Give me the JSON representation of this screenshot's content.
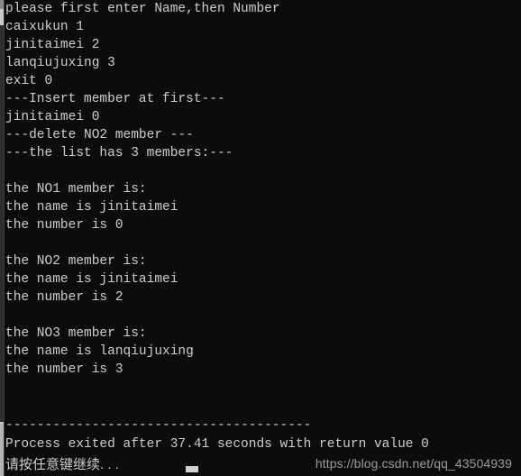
{
  "window": {
    "background_color": "#0c0c0c",
    "text_color": "#cdcdcd",
    "watermark_color": "#9a9a9a",
    "scrollbar_track_color": "#c8c8c8",
    "scrollbar_thumb_color": "#2e2e2e"
  },
  "console": {
    "lines": [
      "please first enter Name,then Number",
      "caixukun 1",
      "jinitaimei 2",
      "lanqiujuxing 3",
      "exit 0",
      "---Insert member at first---",
      "jinitaimei 0",
      "---delete NO2 member ---",
      "---the list has 3 members:---",
      "",
      "the NO1 member is:",
      "the name is jinitaimei",
      "the number is 0",
      "",
      "the NO2 member is:",
      "the name is jinitaimei",
      "the number is 2",
      "",
      "the NO3 member is:",
      "the name is lanqiujuxing",
      "the number is 3",
      "",
      "",
      "",
      ""
    ]
  },
  "footer": {
    "separator": "---------------------------------------",
    "exit_message": "Process exited after 37.41 seconds with return value 0",
    "press_any_key": "请按任意键继续. . .",
    "cursor": "cursor-block",
    "watermark": "https://blog.csdn.net/qq_43504939"
  }
}
